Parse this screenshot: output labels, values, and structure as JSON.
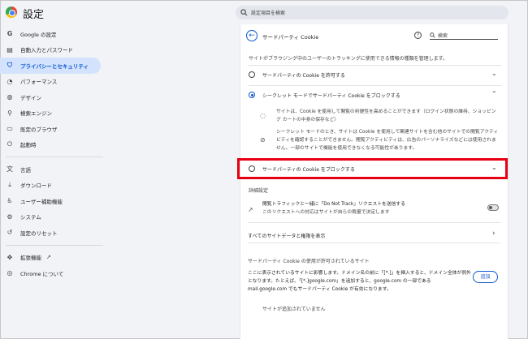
{
  "app": {
    "title": "設定",
    "search_placeholder": "設定項目を検索"
  },
  "sidebar": {
    "items": [
      {
        "label": "Google の設定",
        "icon": "google-icon"
      },
      {
        "label": "自動入力とパスワード",
        "icon": "clipboard-icon"
      },
      {
        "label": "プライバシーとセキュリティ",
        "icon": "shield-icon",
        "active": true
      },
      {
        "label": "パフォーマンス",
        "icon": "speedometer-icon"
      },
      {
        "label": "デザイン",
        "icon": "palette-icon"
      },
      {
        "label": "検索エンジン",
        "icon": "search-icon"
      },
      {
        "label": "既定のブラウザ",
        "icon": "browser-icon"
      },
      {
        "label": "起動時",
        "icon": "power-icon"
      }
    ],
    "items2": [
      {
        "label": "言語",
        "icon": "translate-icon"
      },
      {
        "label": "ダウンロード",
        "icon": "download-icon"
      },
      {
        "label": "ユーザー補助機能",
        "icon": "accessibility-icon"
      },
      {
        "label": "システム",
        "icon": "wrench-icon"
      },
      {
        "label": "設定のリセット",
        "icon": "reset-icon"
      }
    ],
    "items3": [
      {
        "label": "拡張機能",
        "icon": "puzzle-icon"
      },
      {
        "label": "Chrome について",
        "icon": "chrome-icon"
      }
    ]
  },
  "panel": {
    "title": "サードパーティ Cookie",
    "search_label": "検索",
    "description": "サイトがブラウジング中のユーザーのトラッキングに使用できる情報の種類を管理します。",
    "options": [
      {
        "label": "サードパーティの Cookie を許可する",
        "checked": false
      },
      {
        "label": "シークレット モードでサードパーティ Cookie をブロックする",
        "checked": true
      },
      {
        "label": "サードパーティの Cookie をブロックする",
        "checked": false
      }
    ],
    "details": [
      "サイトは、Cookie を使用して閲覧の利便性を高めることができます（ログイン状態の維持、ショッピング カートの中身の保存など）",
      "シークレット モードのとき、サイトは Cookie を使用して関連サイトを含む他のサイトでの閲覧アクティビティを確認することができません。閲覧アクティビティは、広告のパーソナライズなどには使用されません。一部のサイトで機能を使用できなくなる可能性があります。"
    ],
    "advanced_heading": "詳細設定",
    "dnt_line1": "閲覧トラフィックと一緒に「Do Not Track」リクエストを送信する",
    "dnt_line2": "このリクエストへの対応はサイトが自らの裁量で決定します",
    "site_data_link": "すべてのサイトデータと権限を表示",
    "allowed_title": "サードパーティ Cookie の使用が許可されているサイト",
    "allowed_desc": "ここに表示されているサイトに影響します。ドメイン名の前に「[*.]」を挿入すると、ドメイン全体が例外となります。たとえば、「[*.]google.com」を追加すると、google.com の一部である mail.google.com でもサードパーティ Cookie が有効になります。",
    "add_label": "追加",
    "empty_text": "サイトが追加されていません"
  },
  "colors": {
    "accent": "#0b57d0",
    "highlight_box": "#e60012",
    "active_nav_bg": "#d3e3fd"
  }
}
